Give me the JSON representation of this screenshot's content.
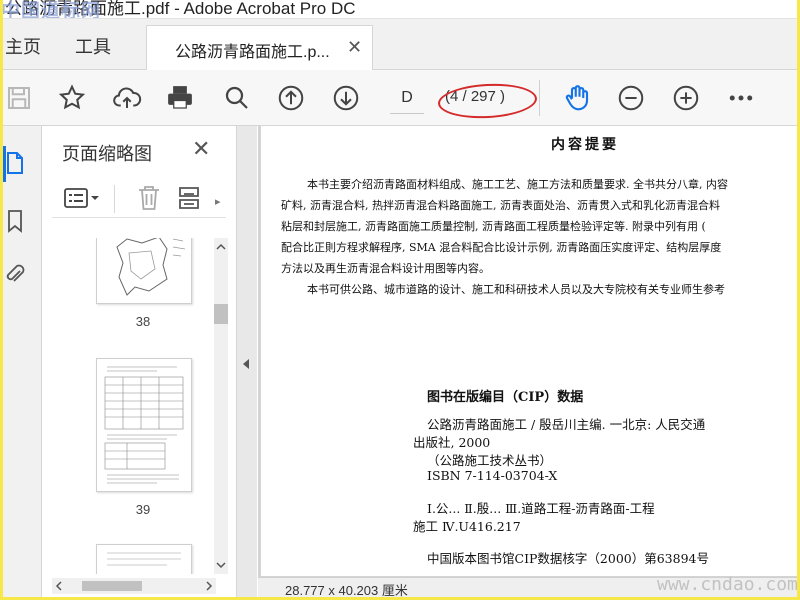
{
  "window": {
    "title": "公路沥青路面施工.pdf - Adobe Acrobat Pro DC",
    "watermark": "中国道标网"
  },
  "tabs": {
    "home": "主页",
    "tools": "工具",
    "document": "公路沥青路面施工.p...",
    "close": "✕"
  },
  "toolbar": {
    "page_input": "D",
    "page_count": "(4 / 297 )",
    "icons": [
      "save-icon",
      "star-icon",
      "cloud-upload-icon",
      "print-icon",
      "search-icon",
      "arrow-up-icon",
      "arrow-down-icon",
      "hand-icon",
      "zoom-out-icon",
      "zoom-in-icon",
      "more-icon"
    ]
  },
  "annotation": {
    "color": "#d42a2a"
  },
  "sidebar": {
    "rail_icons": [
      "page-thumbnails-icon",
      "bookmark-icon",
      "attachment-icon"
    ],
    "panel_title": "页面缩略图",
    "panel_close": "✕",
    "thumbnails": [
      {
        "number": "38"
      },
      {
        "number": "39"
      }
    ]
  },
  "document": {
    "intro_title": "内容提要",
    "intro_lines": [
      "本书主要介绍沥青路面材料组成、施工工艺、施工方法和质量要求. 全书共分八章, 内容",
      "矿料, 沥青混合料, 热拌沥青混合料路面施工, 沥青表面处治、沥青贯入式和乳化沥青混合料",
      "粘层和封层施工, 沥青路面施工质量控制, 沥青路面工程质量检验评定等. 附录中列有用 (",
      "配合比正則方程求解程序, SMA 混合料配合比设计示例, 沥青路面压实度评定、结构层厚度",
      "方法以及再生沥青混合料设计用图等内容。",
      "本书可供公路、城市道路的设计、施工和科研技术人员以及大专院校有关专业师生参考"
    ],
    "cip_title": "图书在版编目（CIP）数据",
    "cip_lines": [
      "公路沥青路面施工 / 殷岳川主编. 一北京: 人民交通",
      "出版社, 2000",
      "（公路施工技术丛书）",
      "ISBN 7-114-03704-X",
      "Ⅰ.公...   Ⅱ.殷...   Ⅲ.道路工程-沥青路面-工程",
      "施工  Ⅳ.U416.217",
      "中国版本图书馆CIP数据核字（2000）第63894号"
    ],
    "page_size": "28.777 x 40.203 厘米",
    "site_watermark": "www.cndao.com"
  },
  "colors": {
    "accent": "#1473e6",
    "frame": "#f7e84a"
  }
}
